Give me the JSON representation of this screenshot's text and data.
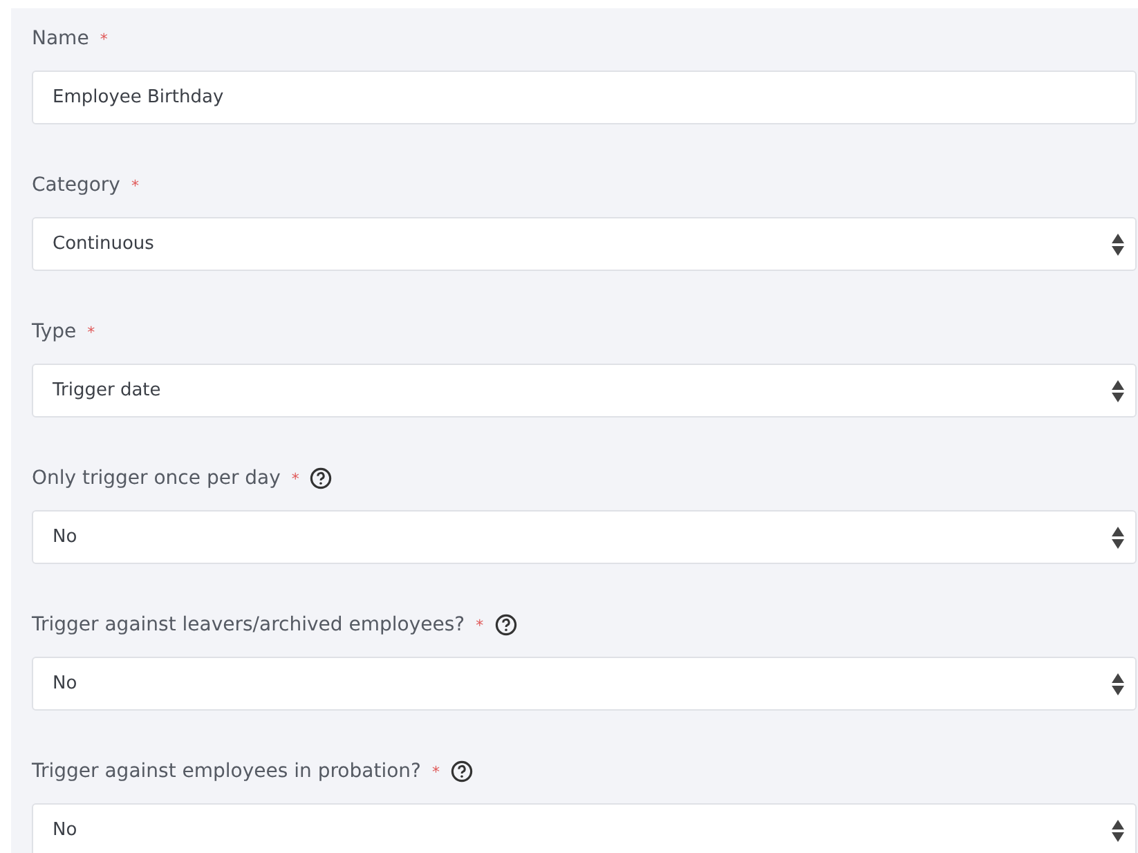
{
  "fields": [
    {
      "kind": "text",
      "label": "Name",
      "required_mark": "*",
      "help": false,
      "value": "Employee Birthday"
    },
    {
      "kind": "select",
      "label": "Category",
      "required_mark": "*",
      "help": false,
      "value": "Continuous"
    },
    {
      "kind": "select",
      "label": "Type",
      "required_mark": "*",
      "help": false,
      "value": "Trigger date"
    },
    {
      "kind": "select",
      "label": "Only trigger once per day",
      "required_mark": "*",
      "help": true,
      "value": "No"
    },
    {
      "kind": "select",
      "label": "Trigger against leavers/archived employees?",
      "required_mark": "*",
      "help": true,
      "value": "No"
    },
    {
      "kind": "select",
      "label": "Trigger against employees in probation?",
      "required_mark": "*",
      "help": true,
      "value": "No"
    }
  ]
}
